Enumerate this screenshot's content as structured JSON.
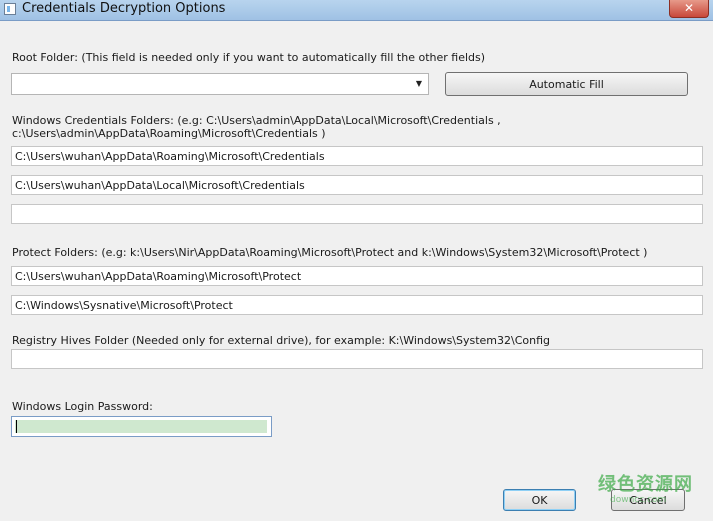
{
  "window": {
    "title": "Credentials Decryption Options",
    "close_glyph": "✕"
  },
  "root_folder": {
    "label": "Root Folder: (This field is needed only if you want to automatically fill the other fields)",
    "value": "",
    "dropdown_glyph": "▼",
    "automatic_fill_label": "Automatic Fill"
  },
  "credentials_folders": {
    "label_line1": "Windows Credentials Folders:  (e.g: C:\\Users\\admin\\AppData\\Local\\Microsoft\\Credentials ,",
    "label_line2": "c:\\Users\\admin\\AppData\\Roaming\\Microsoft\\Credentials )",
    "values": [
      "C:\\Users\\wuhan\\AppData\\Roaming\\Microsoft\\Credentials",
      "C:\\Users\\wuhan\\AppData\\Local\\Microsoft\\Credentials",
      ""
    ]
  },
  "protect_folders": {
    "label": "Protect Folders: (e.g: k:\\Users\\Nir\\AppData\\Roaming\\Microsoft\\Protect and k:\\Windows\\System32\\Microsoft\\Protect )",
    "values": [
      "C:\\Users\\wuhan\\AppData\\Roaming\\Microsoft\\Protect",
      "C:\\Windows\\Sysnative\\Microsoft\\Protect"
    ]
  },
  "registry_hives": {
    "label": "Registry Hives Folder (Needed only for external drive), for example:  K:\\Windows\\System32\\Config",
    "value": ""
  },
  "password": {
    "label": "Windows Login Password:",
    "value": ""
  },
  "buttons": {
    "ok": "OK",
    "cancel": "Cancel"
  },
  "watermark": {
    "text": "绿色资源网",
    "sub": "downcc.com"
  }
}
